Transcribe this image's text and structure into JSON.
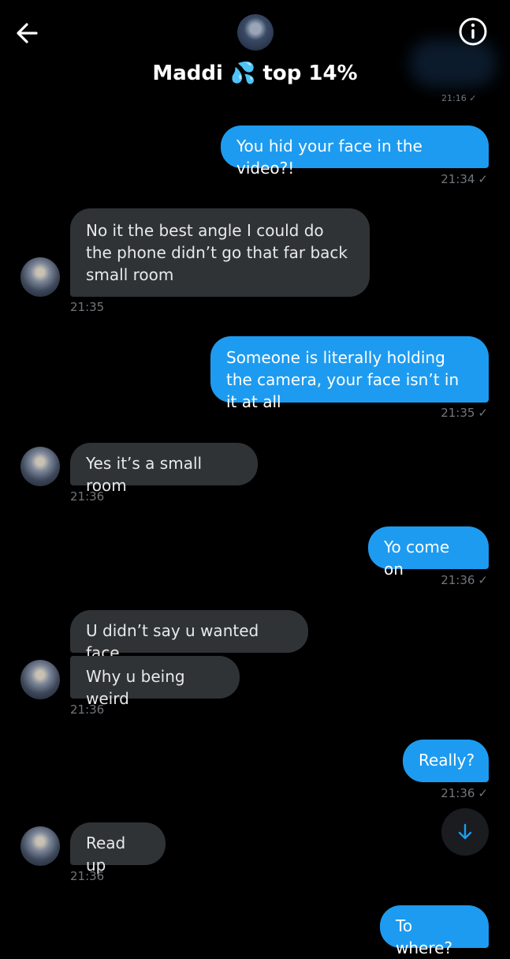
{
  "header": {
    "contact_name": "Maddi 💦 top 14%",
    "peek_time": "21:16 ✓"
  },
  "messages": [
    {
      "dir": "out",
      "text": "You hid your face in the video?!",
      "time": "21:34",
      "check": "✓"
    },
    {
      "dir": "in",
      "text": "No it the best angle I could do the phone didn’t go that far back small room",
      "time": "21:35"
    },
    {
      "dir": "out",
      "text": "Someone is literally holding the camera, your face isn’t in it at all",
      "time": "21:35",
      "check": "✓"
    },
    {
      "dir": "in",
      "text": "Yes it’s a small room",
      "time": "21:36"
    },
    {
      "dir": "out",
      "text": "Yo come on",
      "time": "21:36",
      "check": "✓"
    },
    {
      "dir": "in",
      "text": "U didn’t say u wanted  face"
    },
    {
      "dir": "in",
      "text": "Why u being weird",
      "time": "21:36"
    },
    {
      "dir": "out",
      "text": "Really?",
      "time": "21:36",
      "check": "✓"
    },
    {
      "dir": "in",
      "text": "Read up",
      "time": "21:36"
    },
    {
      "dir": "out",
      "text": "To where?"
    }
  ],
  "icons": {
    "back": "back-arrow-icon",
    "info": "info-icon",
    "scroll": "arrow-down-icon"
  },
  "colors": {
    "outgoing": "#1d9bf0",
    "incoming": "#2f3336",
    "background": "#000000"
  }
}
